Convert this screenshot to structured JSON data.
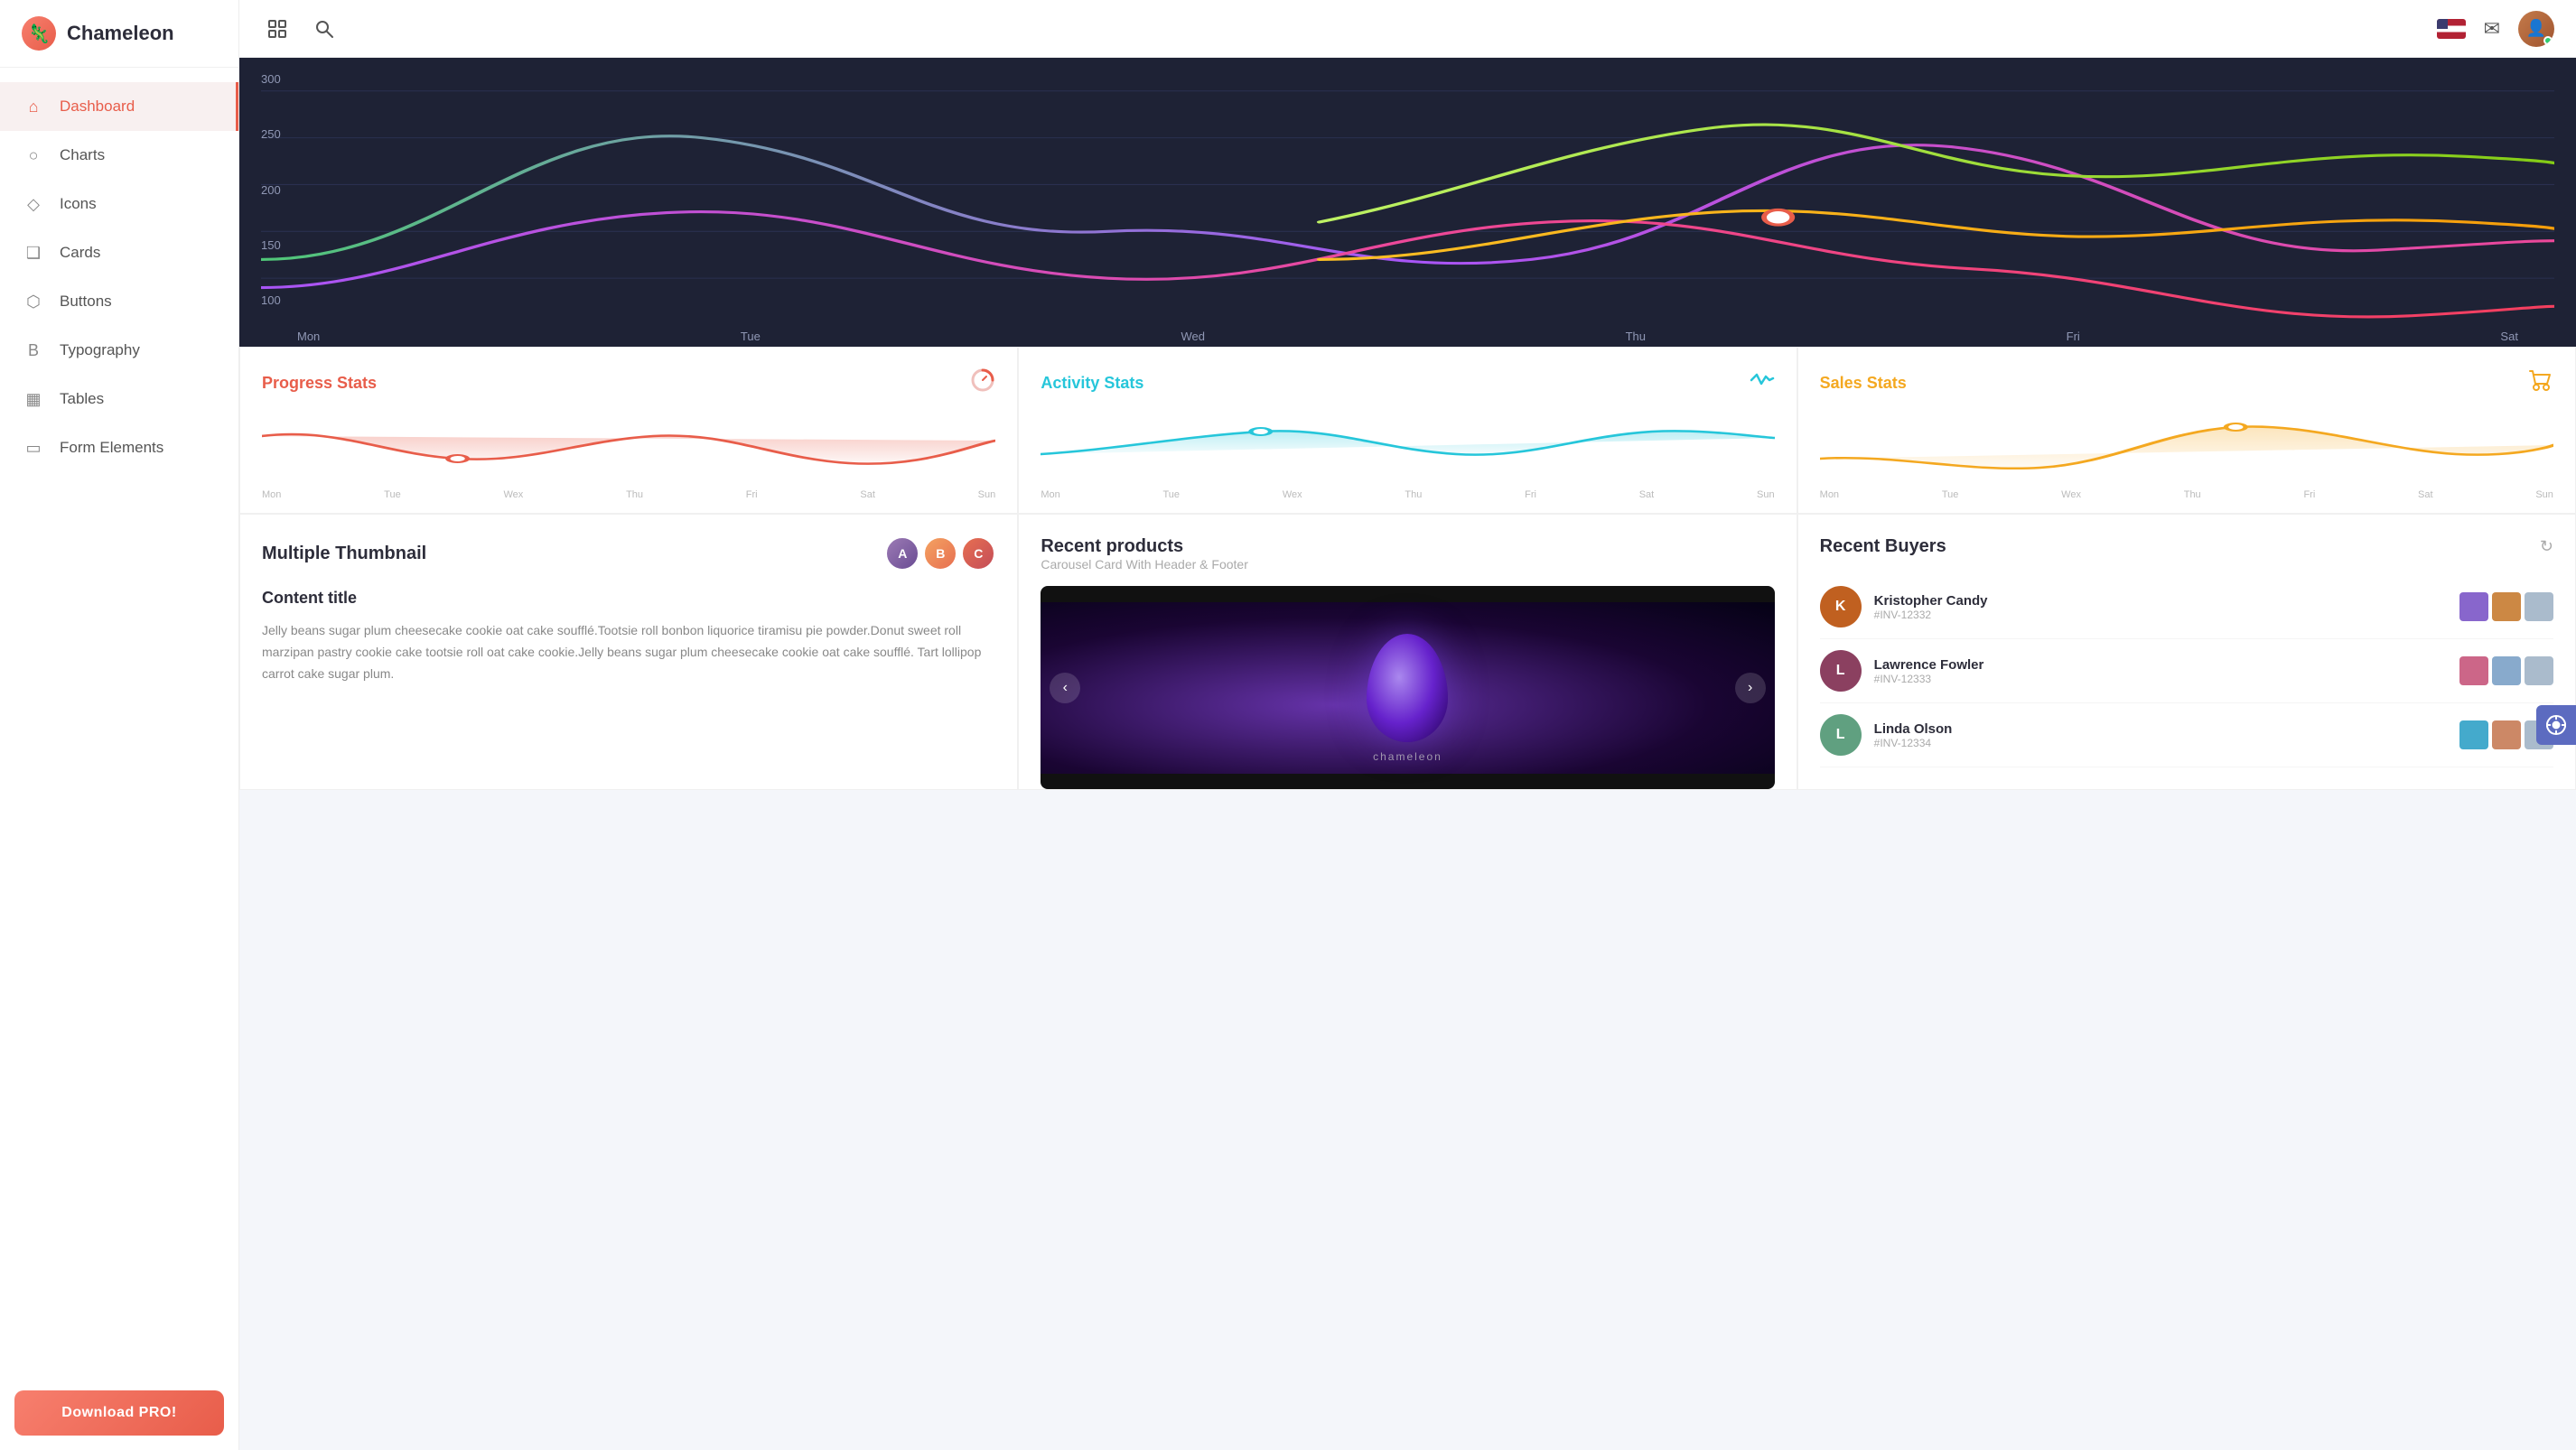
{
  "sidebar": {
    "logo": "Chameleon",
    "items": [
      {
        "id": "dashboard",
        "label": "Dashboard",
        "icon": "⌂",
        "active": true
      },
      {
        "id": "charts",
        "label": "Charts",
        "icon": "○"
      },
      {
        "id": "icons",
        "label": "Icons",
        "icon": "◇"
      },
      {
        "id": "cards",
        "label": "Cards",
        "icon": "❑"
      },
      {
        "id": "buttons",
        "label": "Buttons",
        "icon": "⬡"
      },
      {
        "id": "typography",
        "label": "Typography",
        "icon": "B"
      },
      {
        "id": "tables",
        "label": "Tables",
        "icon": "▦"
      },
      {
        "id": "form-elements",
        "label": "Form Elements",
        "icon": "▭"
      }
    ],
    "download_label": "Download PRO!"
  },
  "topbar": {
    "expand_tooltip": "Expand",
    "search_tooltip": "Search"
  },
  "chart": {
    "y_labels": [
      "300",
      "250",
      "200",
      "150",
      "100"
    ],
    "x_labels": [
      "Mon",
      "Tue",
      "Wed",
      "Thu",
      "Fri",
      "Sat"
    ]
  },
  "stat_cards": [
    {
      "title": "Progress Stats",
      "icon_type": "progress",
      "x_labels": [
        "Mon",
        "Tue",
        "Wex",
        "Thu",
        "Fri",
        "Sat",
        "Sun"
      ],
      "color": "#e85d4a"
    },
    {
      "title": "Activity Stats",
      "icon_type": "activity",
      "x_labels": [
        "Mon",
        "Tue",
        "Wex",
        "Thu",
        "Fri",
        "Sat",
        "Sun"
      ],
      "color": "#26c6da"
    },
    {
      "title": "Sales Stats",
      "icon_type": "sales",
      "x_labels": [
        "Mon",
        "Tue",
        "Wex",
        "Thu",
        "Fri",
        "Sat",
        "Sun"
      ],
      "color": "#f4a820"
    }
  ],
  "multi_card": {
    "title": "Multiple Thumbnail",
    "content_title": "Content title",
    "content_body": "Jelly beans sugar plum cheesecake cookie oat cake soufflé.Tootsie roll bonbon liquorice tiramisu pie powder.Donut sweet roll marzipan pastry cookie cake tootsie roll oat cake cookie.Jelly beans sugar plum cheesecake cookie oat cake soufflé. Tart lollipop carrot cake sugar plum."
  },
  "recent_products": {
    "title": "Recent products",
    "subtitle": "Carousel Card With Header & Footer",
    "brand_label": "chameleon"
  },
  "recent_buyers": {
    "title": "Recent Buyers",
    "buyers": [
      {
        "name": "Kristopher Candy",
        "invoice": "#INV-12332",
        "avatar_color": "#c06020",
        "avatar_initial": "K"
      },
      {
        "name": "Lawrence Fowler",
        "invoice": "#INV-12333",
        "avatar_color": "#8b4060",
        "avatar_initial": "L"
      },
      {
        "name": "Linda Olson",
        "invoice": "#INV-12334",
        "avatar_color": "#60a080",
        "avatar_initial": "L"
      }
    ]
  }
}
